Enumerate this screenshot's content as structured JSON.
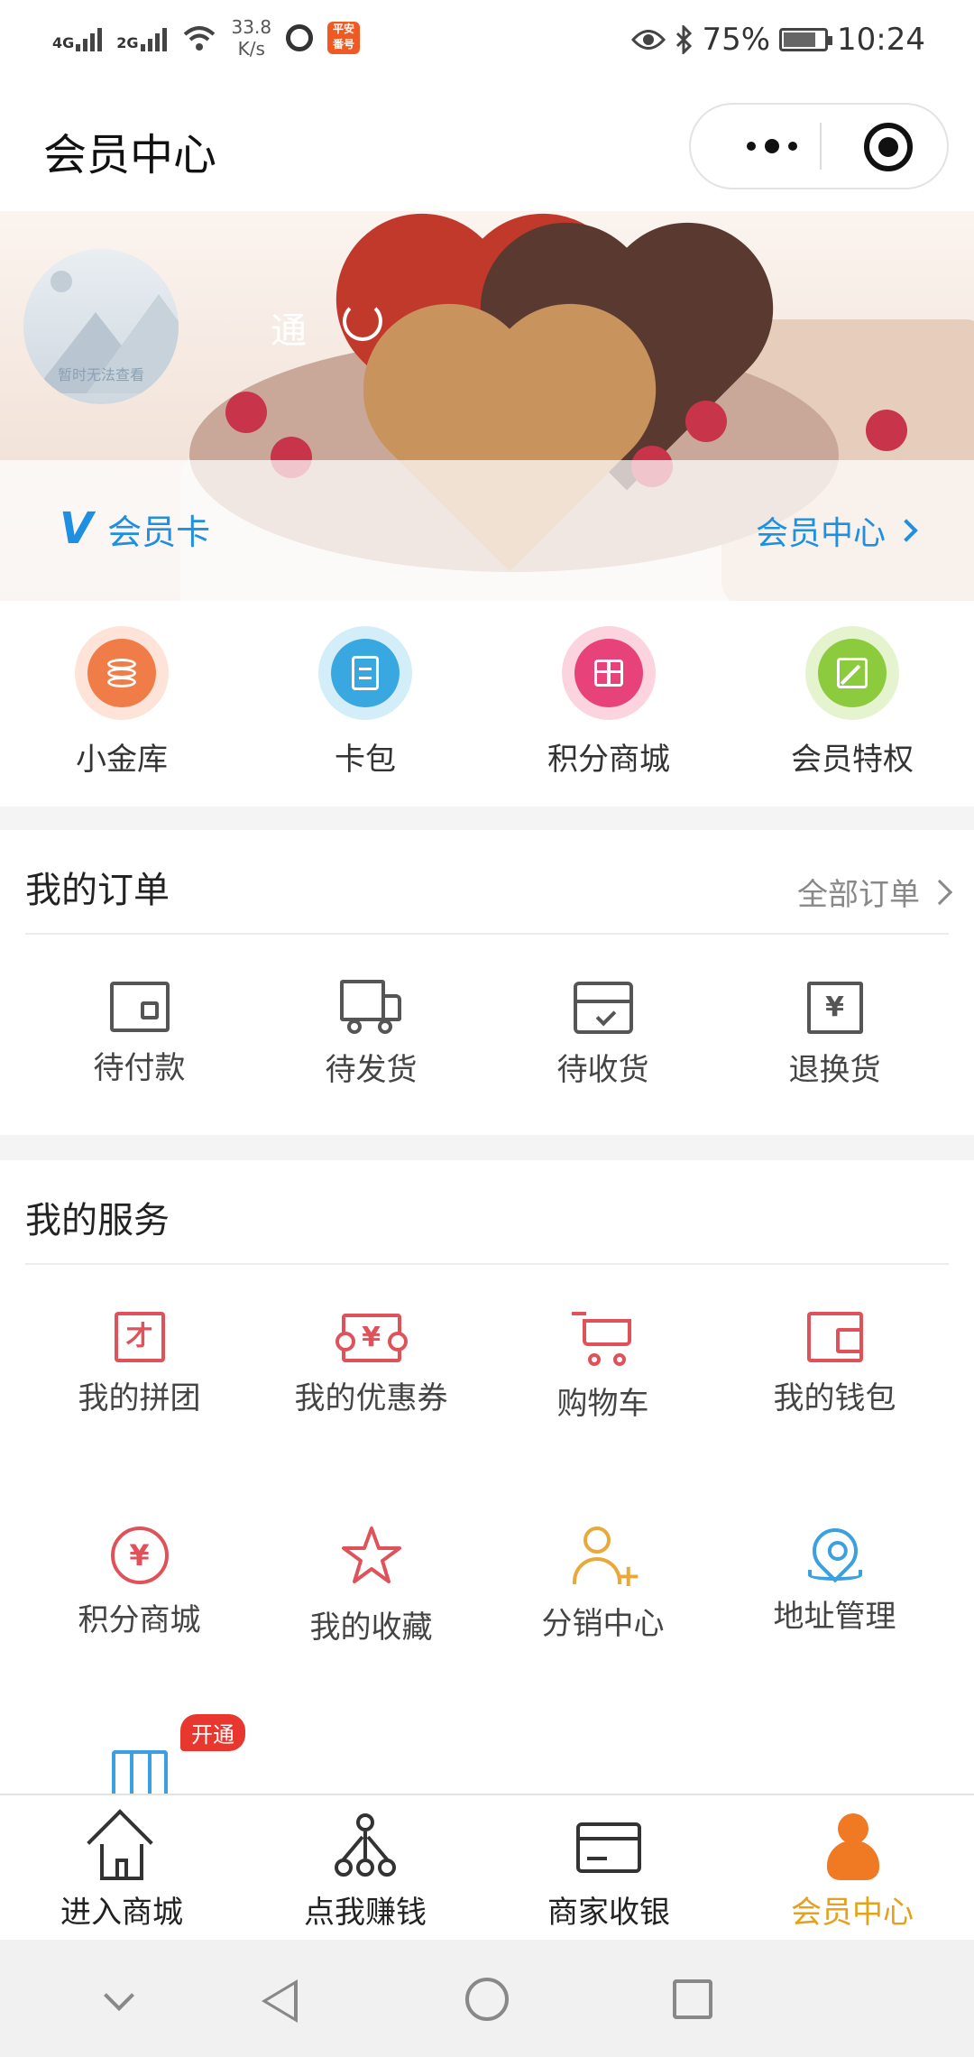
{
  "status_bar": {
    "signal_1": "4G",
    "signal_2": "2G",
    "speed_value": "33.8",
    "speed_unit": "K/s",
    "app_badge": "平安\n番号",
    "battery": "75%",
    "time": "10:24"
  },
  "header": {
    "title": "会员中心"
  },
  "profile": {
    "avatar_caption": "暂时无法查看",
    "name": "通",
    "member_card_label": "会员卡",
    "member_center_link": "会员中心"
  },
  "quick_actions": [
    {
      "label": "小金库",
      "icon": "coins-icon",
      "color": "#f07c48"
    },
    {
      "label": "卡包",
      "icon": "card-wallet-icon",
      "color": "#3aa8e0"
    },
    {
      "label": "积分商城",
      "icon": "gift-icon",
      "color": "#e8427a"
    },
    {
      "label": "会员特权",
      "icon": "edit-icon",
      "color": "#8cca3e"
    }
  ],
  "orders": {
    "title": "我的订单",
    "all_link": "全部订单",
    "items": [
      {
        "label": "待付款",
        "icon": "wallet-icon"
      },
      {
        "label": "待发货",
        "icon": "truck-icon"
      },
      {
        "label": "待收货",
        "icon": "inbox-icon"
      },
      {
        "label": "退换货",
        "icon": "return-icon"
      }
    ]
  },
  "services": {
    "title": "我的服务",
    "items": [
      {
        "label": "我的拼团",
        "icon": "group-buy-icon",
        "glyph": "才"
      },
      {
        "label": "我的优惠券",
        "icon": "coupon-icon",
        "glyph": "¥"
      },
      {
        "label": "购物车",
        "icon": "cart-icon"
      },
      {
        "label": "我的钱包",
        "icon": "wallet-icon"
      },
      {
        "label": "积分商城",
        "icon": "yen-circle-icon",
        "glyph": "¥"
      },
      {
        "label": "我的收藏",
        "icon": "star-icon"
      },
      {
        "label": "分销中心",
        "icon": "add-user-icon"
      },
      {
        "label": "地址管理",
        "icon": "location-pin-icon"
      }
    ],
    "badge": "开通",
    "accent": "#e0525a"
  },
  "tabbar": {
    "items": [
      {
        "label": "进入商城",
        "icon": "home-icon"
      },
      {
        "label": "点我赚钱",
        "icon": "share-tree-icon"
      },
      {
        "label": "商家收银",
        "icon": "bank-card-icon"
      },
      {
        "label": "会员中心",
        "icon": "person-icon",
        "active": true
      }
    ],
    "active_color": "#e6a11a"
  }
}
